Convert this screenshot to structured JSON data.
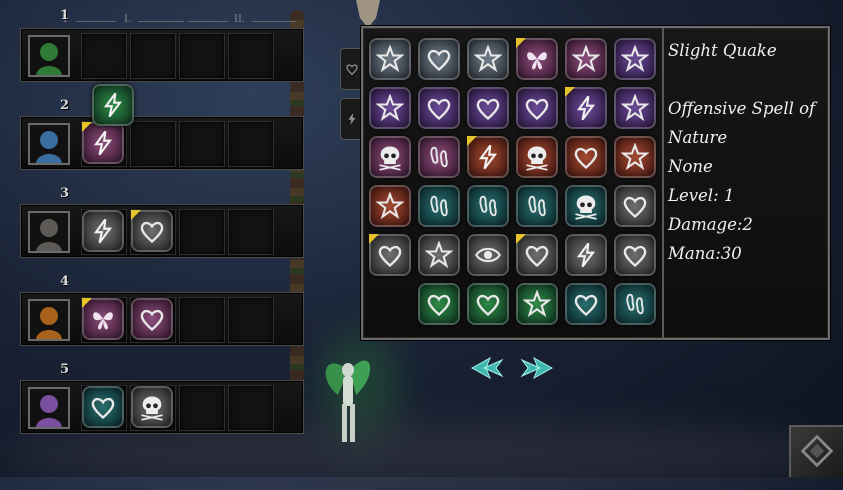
{
  "party": {
    "column_headers": [
      "1",
      "I.",
      "II."
    ],
    "rows": [
      {
        "number": "1",
        "portrait": "green-hero-portrait",
        "runes": []
      },
      {
        "number": "2",
        "portrait": "blue-golem-portrait",
        "runes": [
          {
            "symbol": "lightning-icon",
            "color": "pink",
            "flag": true
          }
        ]
      },
      {
        "number": "3",
        "portrait": "gray-beast-portrait",
        "runes": [
          {
            "symbol": "lightning-icon",
            "color": "gray",
            "flag": false
          },
          {
            "symbol": "heart-icon",
            "color": "gray",
            "flag": true
          }
        ]
      },
      {
        "number": "4",
        "portrait": "orange-imp-portrait",
        "runes": [
          {
            "symbol": "butterfly-icon",
            "color": "pink",
            "flag": true
          },
          {
            "symbol": "heart-icon",
            "color": "pink",
            "flag": false
          }
        ]
      },
      {
        "number": "5",
        "portrait": "purple-dragon-portrait",
        "runes": [
          {
            "symbol": "heart-icon",
            "color": "teal",
            "flag": false
          },
          {
            "symbol": "skull-icon",
            "color": "gray",
            "flag": false
          }
        ]
      }
    ],
    "dragged_rune": {
      "symbol": "lightning-icon",
      "color": "green"
    }
  },
  "spell_grid": [
    [
      {
        "s": "star-icon",
        "c": "silver",
        "f": false
      },
      {
        "s": "heart-icon",
        "c": "silver",
        "f": false
      },
      {
        "s": "star-icon",
        "c": "silver",
        "f": false
      },
      {
        "s": "butterfly-icon",
        "c": "pink",
        "f": true
      },
      {
        "s": "star-icon",
        "c": "pink",
        "f": false
      },
      {
        "s": "star-icon",
        "c": "purple",
        "f": false
      }
    ],
    [
      {
        "s": "star-icon",
        "c": "purple",
        "f": false
      },
      {
        "s": "heart-icon",
        "c": "purple",
        "f": false
      },
      {
        "s": "heart-icon",
        "c": "purple",
        "f": false
      },
      {
        "s": "heart-icon",
        "c": "purple",
        "f": false
      },
      {
        "s": "lightning-icon",
        "c": "purple",
        "f": true
      },
      {
        "s": "star-icon",
        "c": "purple",
        "f": false
      }
    ],
    [
      {
        "s": "skull-icon",
        "c": "pink",
        "f": false
      },
      {
        "s": "footprint-icon",
        "c": "pink",
        "f": false
      },
      {
        "s": "lightning-icon",
        "c": "rust",
        "f": true
      },
      {
        "s": "skull-icon",
        "c": "rust",
        "f": false
      },
      {
        "s": "heart-icon",
        "c": "rust",
        "f": false
      },
      {
        "s": "star-icon",
        "c": "rust",
        "f": false
      }
    ],
    [
      {
        "s": "star-icon",
        "c": "rust",
        "f": false
      },
      {
        "s": "footprint-icon",
        "c": "teal",
        "f": false
      },
      {
        "s": "footprint-icon",
        "c": "teal",
        "f": false
      },
      {
        "s": "footprint-icon",
        "c": "teal",
        "f": false
      },
      {
        "s": "skull-icon",
        "c": "teal",
        "f": false
      },
      {
        "s": "heart-icon",
        "c": "gray",
        "f": false
      }
    ],
    [
      {
        "s": "heart-icon",
        "c": "gray",
        "f": true
      },
      {
        "s": "star-icon",
        "c": "gray",
        "f": false
      },
      {
        "s": "eye-icon",
        "c": "gray",
        "f": false
      },
      {
        "s": "heart-icon",
        "c": "gray",
        "f": true
      },
      {
        "s": "lightning-icon",
        "c": "gray",
        "f": false
      },
      {
        "s": "heart-icon",
        "c": "gray",
        "f": false
      }
    ],
    [
      null,
      {
        "s": "heart-icon",
        "c": "green",
        "f": false
      },
      {
        "s": "heart-icon",
        "c": "green",
        "f": false
      },
      {
        "s": "star-icon",
        "c": "green",
        "f": false
      },
      {
        "s": "heart-icon",
        "c": "teal",
        "f": false
      },
      {
        "s": "footprint-icon",
        "c": "teal",
        "f": false
      }
    ]
  ],
  "spell_info": {
    "name": "Slight Quake",
    "type": "Offensive Spell of Nature",
    "element": "None",
    "level": "Level: 1",
    "damage": "Damage:2",
    "mana": "Mana:30"
  },
  "side_tabs": [
    "heart-icon",
    "lightning-icon"
  ],
  "nav": {
    "prev": "prev-arrow-icon",
    "next": "next-arrow-icon"
  },
  "colors": {
    "teal": "#2a6d6d",
    "silver": "#6f7b87",
    "purple": "#6b4a96",
    "pink": "#8a4d7a",
    "rust": "#a34a32",
    "green": "#2f8a45",
    "gray": "#6e6e6e",
    "flag": "#e6c22b"
  }
}
